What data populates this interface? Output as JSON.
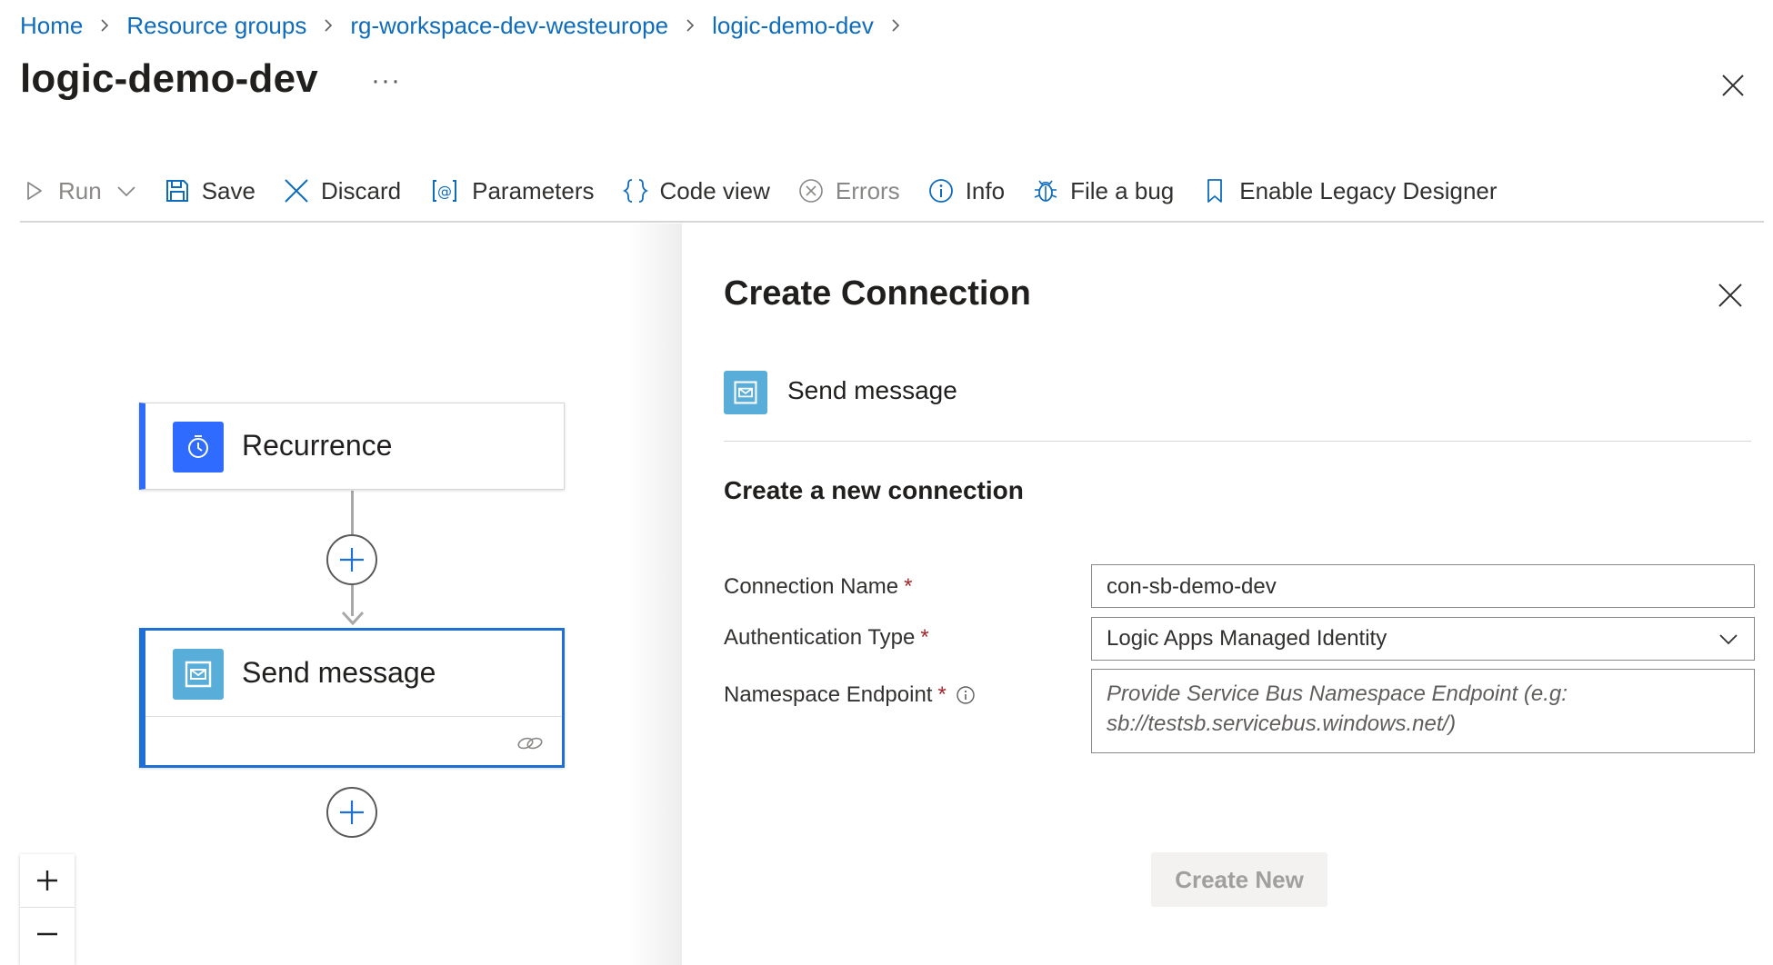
{
  "breadcrumb": {
    "items": [
      "Home",
      "Resource groups",
      "rg-workspace-dev-westeurope",
      "logic-demo-dev"
    ]
  },
  "header": {
    "title": "logic-demo-dev",
    "more_label": "···"
  },
  "toolbar": {
    "run_label": "Run",
    "save_label": "Save",
    "discard_label": "Discard",
    "parameters_label": "Parameters",
    "code_view_label": "Code view",
    "errors_label": "Errors",
    "info_label": "Info",
    "file_bug_label": "File a bug",
    "legacy_label": "Enable Legacy Designer"
  },
  "workflow": {
    "trigger": {
      "title": "Recurrence",
      "icon": "clock-icon"
    },
    "action": {
      "title": "Send message",
      "icon": "service-bus-icon"
    }
  },
  "zoom": {
    "in_label": "+",
    "out_label": "−"
  },
  "panel": {
    "title": "Create Connection",
    "operation_name": "Send message",
    "subtitle": "Create a new connection",
    "fields": {
      "connection_name": {
        "label": "Connection Name",
        "required_mark": "*",
        "value": "con-sb-demo-dev"
      },
      "auth_type": {
        "label": "Authentication Type",
        "required_mark": "*",
        "value": "Logic Apps Managed Identity"
      },
      "namespace": {
        "label": "Namespace Endpoint",
        "required_mark": "*",
        "placeholder": "Provide Service Bus Namespace Endpoint (e.g: sb://testsb.servicebus.windows.net/)"
      }
    },
    "create_button_label": "Create New"
  },
  "colors": {
    "link": "#0f6cbd",
    "trigger_accent": "#2f6bff",
    "service_bus": "#59aed9",
    "selected_border": "#1e6fd6",
    "required": "#a4262c"
  }
}
